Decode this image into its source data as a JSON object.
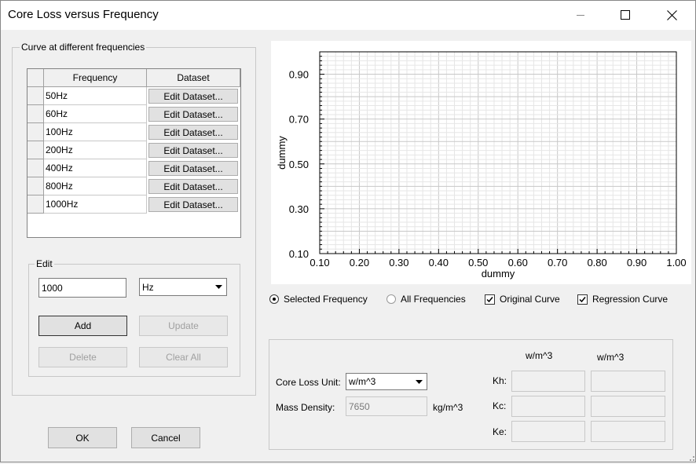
{
  "window": {
    "title": "Core Loss versus Frequency"
  },
  "curve_group": {
    "legend": "Curve at different frequencies",
    "columns": [
      "Frequency",
      "Dataset"
    ],
    "rows": [
      {
        "frequency": "50Hz",
        "dataset": "Edit Dataset..."
      },
      {
        "frequency": "60Hz",
        "dataset": "Edit Dataset..."
      },
      {
        "frequency": "100Hz",
        "dataset": "Edit Dataset..."
      },
      {
        "frequency": "200Hz",
        "dataset": "Edit Dataset..."
      },
      {
        "frequency": "400Hz",
        "dataset": "Edit Dataset..."
      },
      {
        "frequency": "800Hz",
        "dataset": "Edit Dataset..."
      },
      {
        "frequency": "1000Hz",
        "dataset": "Edit Dataset..."
      }
    ]
  },
  "edit_group": {
    "legend": "Edit",
    "value": "1000",
    "unit": "Hz",
    "add": "Add",
    "update": "Update",
    "delete": "Delete",
    "clear_all": "Clear All"
  },
  "chart_data": {
    "type": "line",
    "xlabel": "dummy",
    "ylabel": "dummy",
    "xlim": [
      0.1,
      1.0
    ],
    "ylim": [
      0.1,
      1.0
    ],
    "x_ticks": [
      "0.10",
      "0.20",
      "0.30",
      "0.40",
      "0.50",
      "0.60",
      "0.70",
      "0.80",
      "0.90",
      "1.00"
    ],
    "y_ticks": [
      "0.10",
      "0.30",
      "0.50",
      "0.70",
      "0.90"
    ],
    "y_tick_values": [
      0.1,
      0.3,
      0.5,
      0.7,
      0.9
    ],
    "series": [],
    "grid": true,
    "grid_color": "#d4d4d4"
  },
  "options": {
    "selected_frequency": {
      "label": "Selected Frequency",
      "checked": true
    },
    "all_frequencies": {
      "label": "All Frequencies",
      "checked": false
    },
    "original_curve": {
      "label": "Original Curve",
      "checked": true
    },
    "regression_curve": {
      "label": "Regression Curve",
      "checked": true
    }
  },
  "coefficients": {
    "core_loss_unit_label": "Core Loss Unit:",
    "core_loss_unit": "w/m^3",
    "mass_density_label": "Mass Density:",
    "mass_density": "7650",
    "mass_density_unit": "kg/m^3",
    "col1_unit": "w/m^3",
    "col2_unit": "w/m^3",
    "kh_label": "Kh:",
    "kc_label": "Kc:",
    "ke_label": "Ke:"
  },
  "footer": {
    "ok": "OK",
    "cancel": "Cancel"
  }
}
